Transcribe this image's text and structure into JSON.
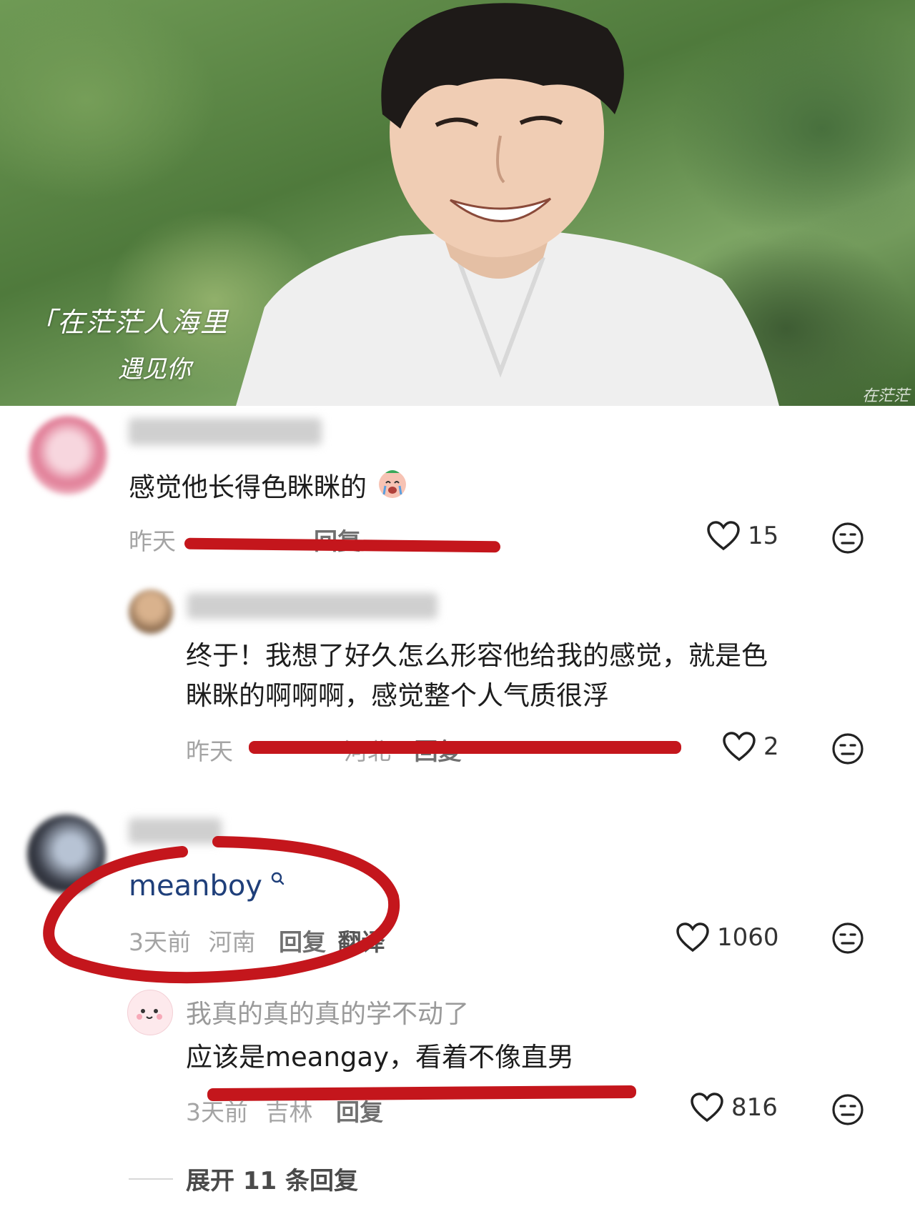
{
  "hero": {
    "caption_line1": "「在茫茫人海里",
    "caption_line2": "遇见你",
    "watermark": "在茫茫"
  },
  "comments": [
    {
      "username": "",
      "text": "感觉他长得色眯眯的",
      "time": "昨天",
      "reply_label": "回复",
      "likes": "15",
      "replies": [
        {
          "username": "",
          "text_line1": "终于！我想了好久怎么形容他给我的感觉，就是色",
          "text_line2": "眯眯的啊啊啊，感觉整个人气质很浮",
          "time": "昨天",
          "location": "河北",
          "reply_label": "回复",
          "likes": "2"
        }
      ]
    },
    {
      "username": "",
      "text": "meanboy",
      "time": "3天前",
      "location": "河南",
      "reply_label": "回复",
      "translate_label": "翻译",
      "likes": "1060",
      "replies": [
        {
          "username": "我真的真的真的学不动了",
          "text": "应该是meangay，看着不像直男",
          "time": "3天前",
          "location": "吉林",
          "reply_label": "回复",
          "likes": "816"
        }
      ],
      "expand_label": "展开 11 条回复"
    }
  ],
  "icons": [
    "heart-icon",
    "meh-face-icon",
    "search-icon",
    "emoji-icon"
  ],
  "colors": {
    "annotation_red": "#c4161c",
    "link_blue": "#1f3f7a"
  }
}
